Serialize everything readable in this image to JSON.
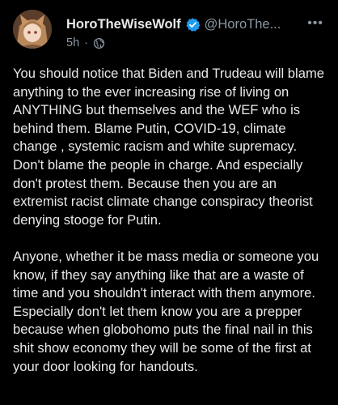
{
  "post": {
    "display_name": "HoroTheWiseWolf",
    "handle": "@HoroThe...",
    "time": "5h",
    "meta_separator": "·",
    "more_label": "•••",
    "paragraphs": [
      "You should notice that Biden and Trudeau will blame anything to the ever increasing rise of living on ANYTHING but themselves and the WEF who is behind them. Blame Putin, COVID-19, climate change , systemic racism and white supremacy. Don't blame the people in charge. And especially don't protest them. Because then you are an extremist racist climate change conspiracy theorist denying stooge for Putin.",
      "Anyone, whether it be mass media or someone you know, if they say anything like that are a waste of time and you shouldn't interact with them anymore. Especially don't let them know you are a prepper because when globohomo puts the final nail in this shit show economy they will be some of the first at your door looking for handouts."
    ]
  },
  "icons": {
    "verified": "verified-badge-icon",
    "audience": "globe-icon",
    "more": "more-options-icon"
  },
  "colors": {
    "background": "#000000",
    "text_primary": "#e7e9ea",
    "text_secondary": "#8b98a5",
    "verified_blue": "#1d9bf0"
  }
}
